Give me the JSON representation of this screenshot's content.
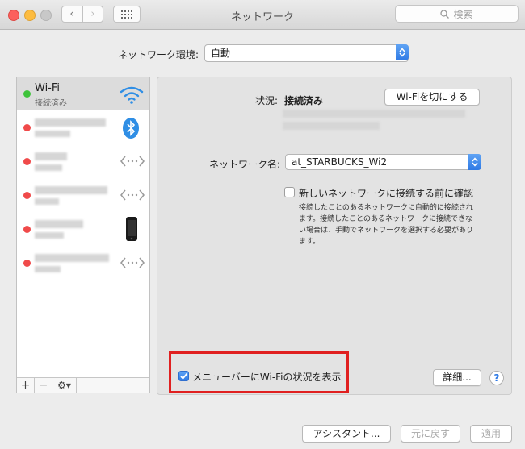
{
  "window": {
    "title": "ネットワーク"
  },
  "search": {
    "placeholder": "検索"
  },
  "location": {
    "label": "ネットワーク環境:",
    "value": "自動"
  },
  "services": [
    {
      "name": "Wi-Fi",
      "status": "接続済み",
      "icon": "wifi-icon",
      "state": "connected"
    },
    {
      "icon": "bluetooth-icon",
      "state": "disconnected"
    },
    {
      "icon": "ethernet-arrows-icon",
      "state": "disconnected"
    },
    {
      "icon": "ethernet-arrows-icon",
      "state": "disconnected"
    },
    {
      "icon": "iphone-icon",
      "state": "disconnected"
    },
    {
      "icon": "ethernet-arrows-icon",
      "state": "disconnected"
    }
  ],
  "sidebar_footer": {
    "add": "+",
    "remove": "−",
    "gear": "⚙▾"
  },
  "status": {
    "label": "状況:",
    "value": "接続済み",
    "toggle_button": "Wi-Fiを切にする"
  },
  "network_name": {
    "label": "ネットワーク名:",
    "value": "at_STARBUCKS_Wi2"
  },
  "ask_join": {
    "label": "新しいネットワークに接続する前に確認",
    "checked": false,
    "description": [
      "接続したことのあるネットワークに自動的に接続され",
      "ます。接続したことのあるネットワークに接続できな",
      "い場合は、手動でネットワークを選択する必要があり",
      "ます。"
    ]
  },
  "menubar_status": {
    "label": "メニューバーにWi-Fiの状況を表示",
    "checked": true
  },
  "buttons": {
    "advanced": "詳細...",
    "help": "?",
    "assistant": "アシスタント...",
    "revert": "元に戻す",
    "apply": "適用"
  },
  "colors": {
    "accent": "#2f7ae5",
    "connected": "#3ec33a",
    "disconnected": "#f04a4a",
    "highlight": "#e02020"
  }
}
